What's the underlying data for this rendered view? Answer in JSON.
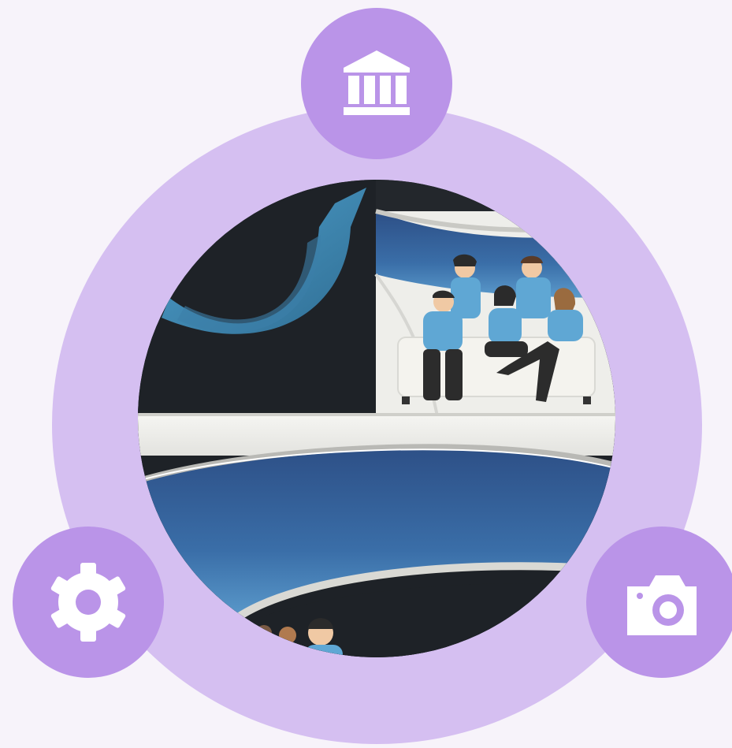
{
  "diagram": {
    "hub": {
      "image": "people-on-sofa-tv-studio-illustration"
    },
    "nodes": [
      {
        "id": "top",
        "icon": "bank-icon"
      },
      {
        "id": "left",
        "icon": "gear-icon"
      },
      {
        "id": "right",
        "icon": "camera-icon"
      }
    ]
  },
  "colors": {
    "background": "#f7f3fa",
    "ring": "#d5bff1",
    "node": "#ba94e8",
    "icon": "#ffffff",
    "studio_dark": "#1e2227",
    "studio_blue": "#3a6ea8",
    "shirt": "#5fa7d4"
  }
}
